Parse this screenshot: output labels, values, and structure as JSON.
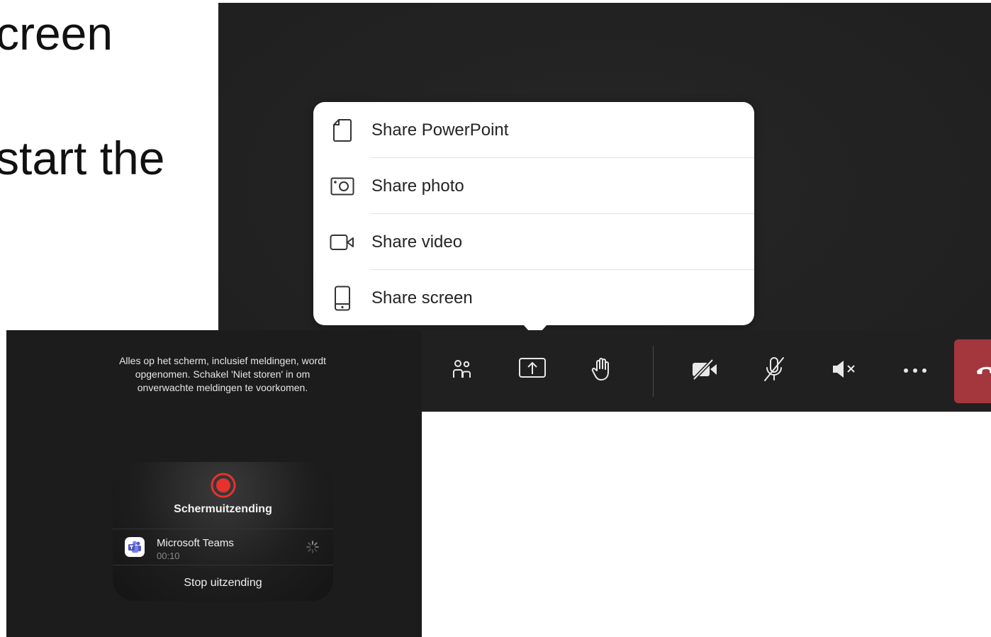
{
  "slide": {
    "line1": "creen",
    "line2": "start the"
  },
  "share_menu": {
    "items": [
      {
        "label": "Share PowerPoint",
        "icon": "document-icon"
      },
      {
        "label": "Share photo",
        "icon": "photo-icon"
      },
      {
        "label": "Share video",
        "icon": "video-icon"
      },
      {
        "label": "Share screen",
        "icon": "phone-screen-icon"
      }
    ]
  },
  "toolbar": {
    "buttons": [
      "people-icon",
      "share-tray-icon",
      "raise-hand-icon",
      "camera-off-icon",
      "mic-off-icon",
      "speaker-mute-icon",
      "more-icon",
      "hang-up-icon"
    ],
    "hangup_color": "#a4373e"
  },
  "broadcast": {
    "hint": "Alles op het scherm, inclusief meldingen, wordt opgenomen. Schakel 'Niet storen' in om onverwachte meldingen te voorkomen.",
    "title": "Schermuitzending",
    "app_name": "Microsoft Teams",
    "elapsed": "00:10",
    "stop_label": "Stop uitzending",
    "record_color": "#e5322d"
  }
}
